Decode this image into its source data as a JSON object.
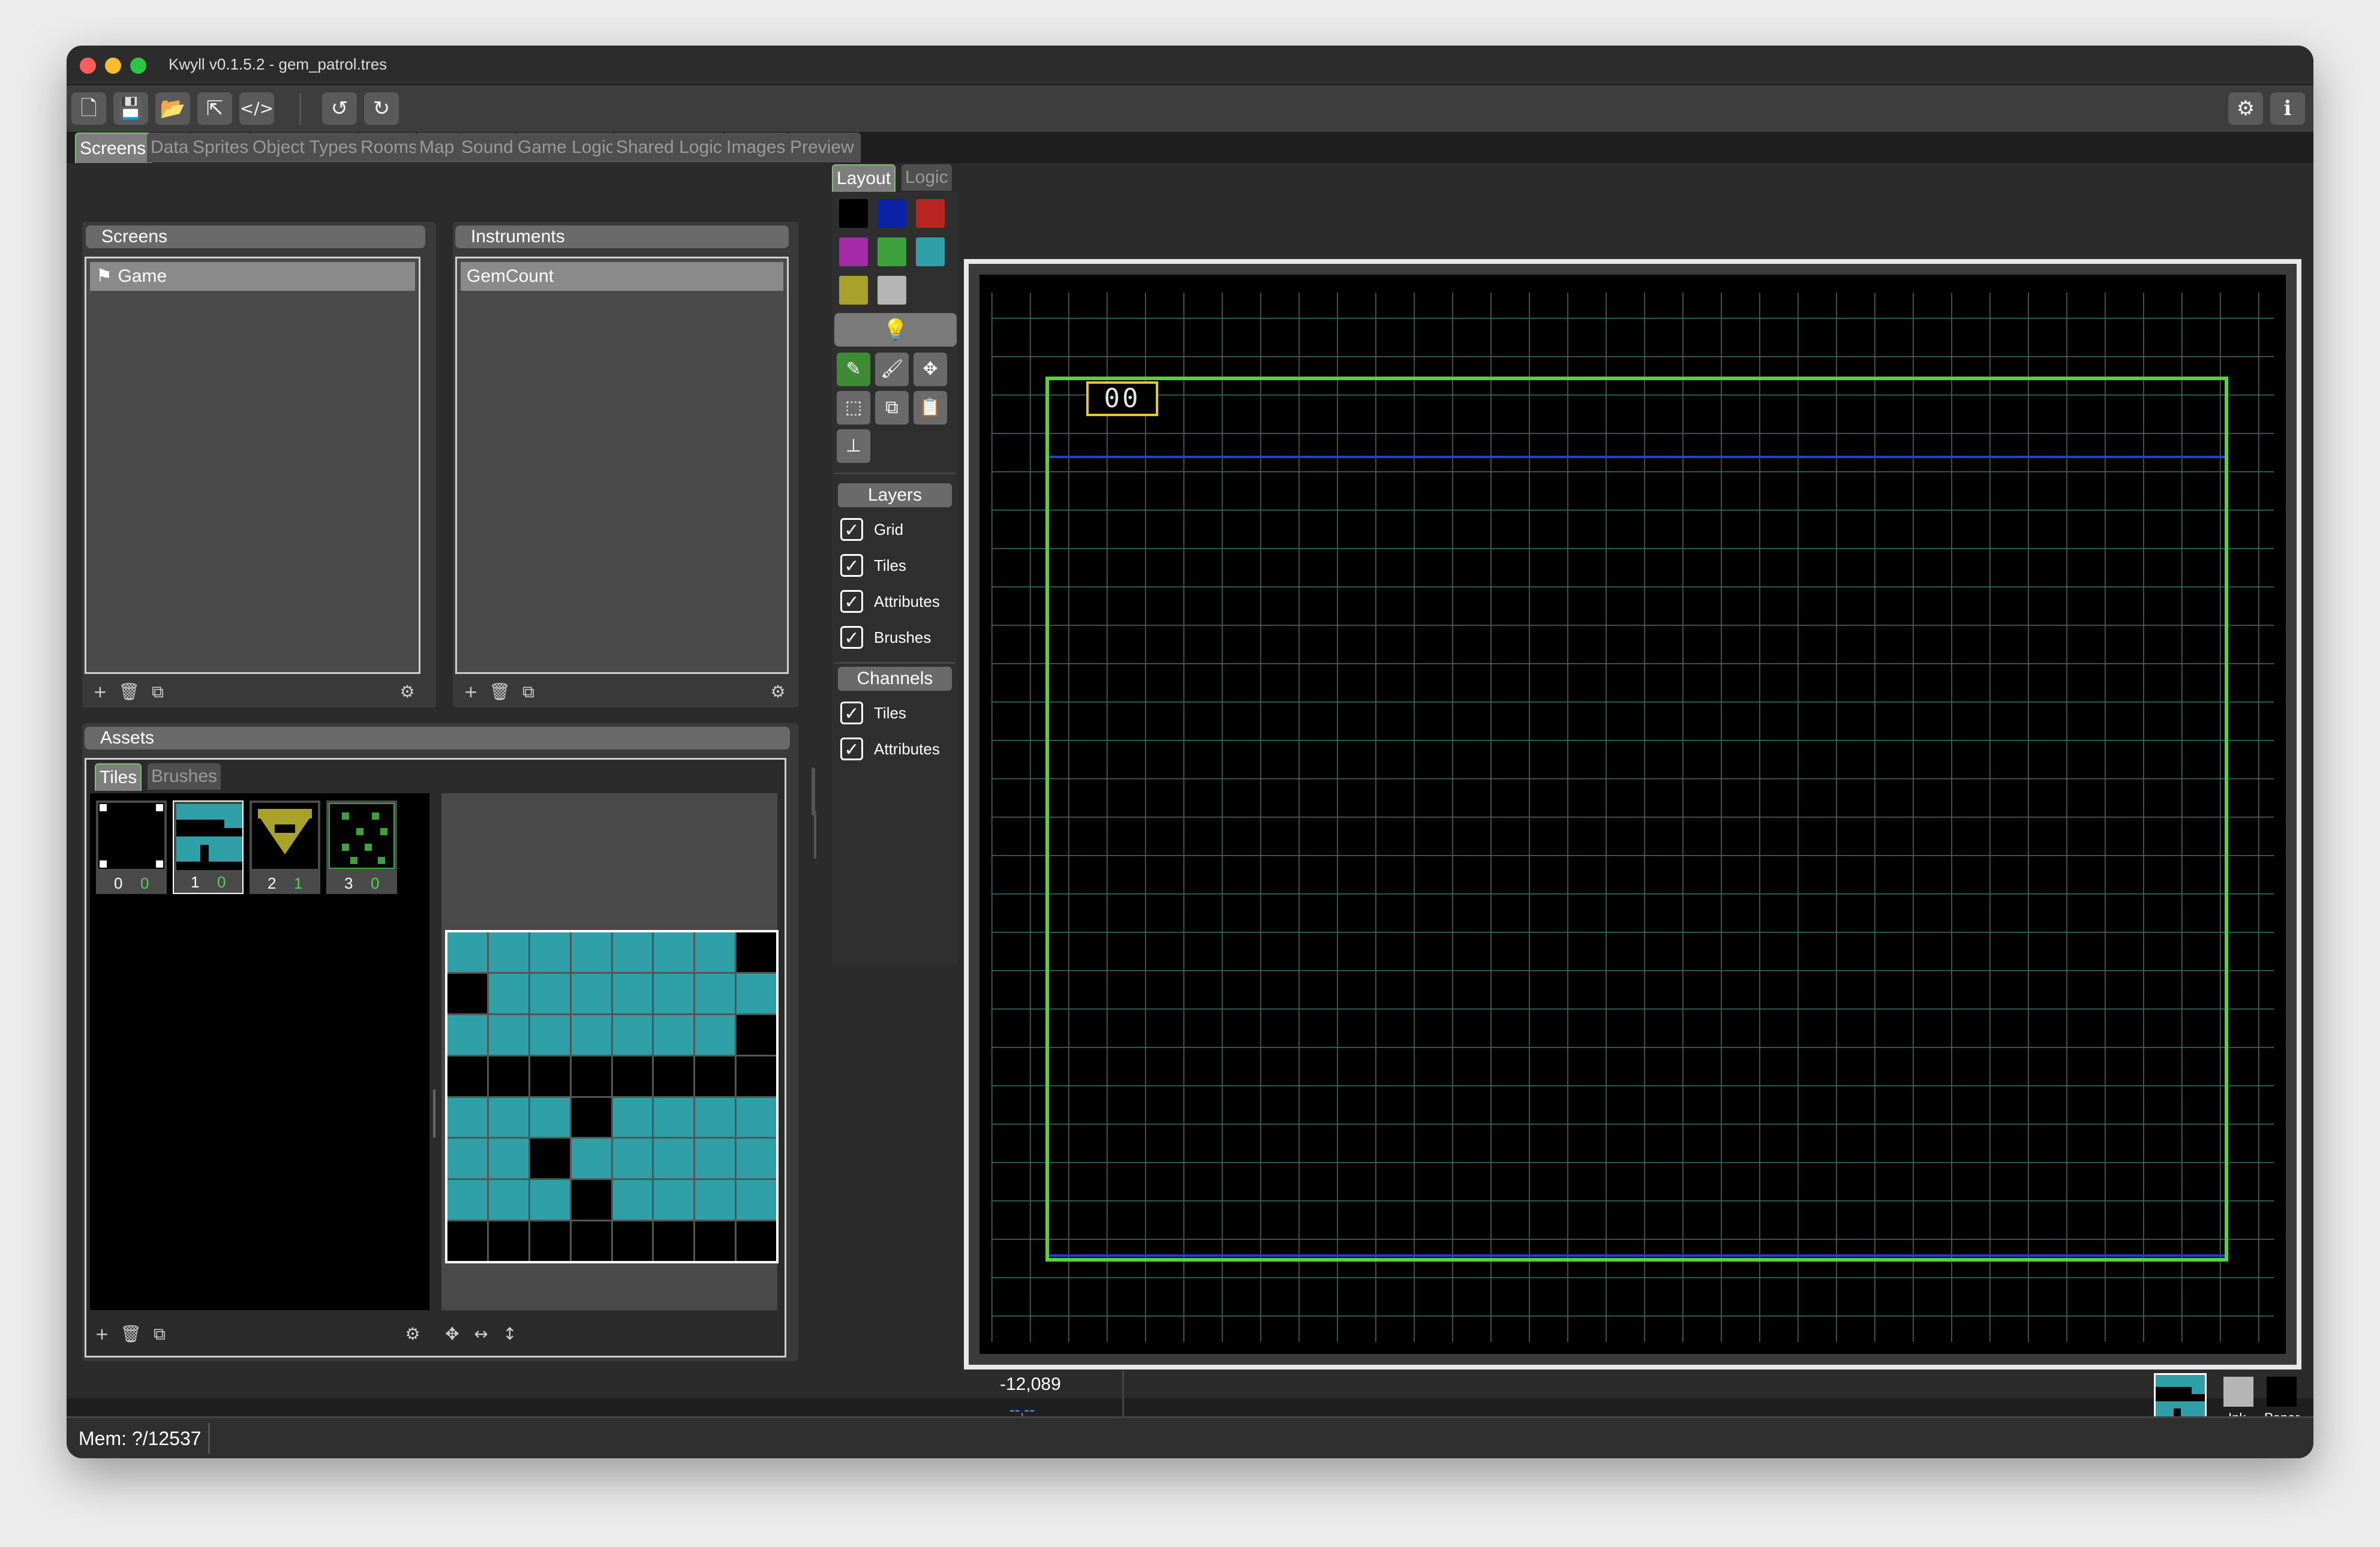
{
  "window": {
    "title": "Kwyll v0.1.5.2 - gem_patrol.tres",
    "colors": {
      "close": "#ff5f57",
      "minimize": "#febc2e",
      "zoom": "#28c840",
      "accent": "#77c46a"
    }
  },
  "toolbar": {
    "icons": [
      "new-file-icon",
      "save-icon",
      "open-folder-icon",
      "export-icon",
      "code-icon",
      "undo-icon",
      "redo-icon",
      "settings-icon",
      "info-icon"
    ]
  },
  "tabs": [
    {
      "label": "Screens",
      "active": true
    },
    {
      "label": "Data"
    },
    {
      "label": "Sprites"
    },
    {
      "label": "Object Types"
    },
    {
      "label": "Rooms"
    },
    {
      "label": "Map"
    },
    {
      "label": "Sound"
    },
    {
      "label": "Game Logic"
    },
    {
      "label": "Shared Logic"
    },
    {
      "label": "Images"
    },
    {
      "label": "Preview"
    }
  ],
  "screens_panel": {
    "title": "Screens",
    "items": [
      "Game"
    ]
  },
  "instruments_panel": {
    "title": "Instruments",
    "items": [
      "GemCount"
    ]
  },
  "assets": {
    "title": "Assets",
    "subtabs": [
      "Tiles",
      "Brushes"
    ],
    "tiles": [
      {
        "index": "0",
        "attr": "0"
      },
      {
        "index": "1",
        "attr": "0"
      },
      {
        "index": "2",
        "attr": "1"
      },
      {
        "index": "3",
        "attr": "0"
      }
    ]
  },
  "editor": {
    "subtabs": [
      "Layout",
      "Logic"
    ],
    "palette": [
      "#000000",
      "#0b22a8",
      "#b8241e",
      "#a52aa8",
      "#3ca33c",
      "#2fa0a8",
      "#a8a22c",
      "#b5b5b5"
    ],
    "layers": {
      "title": "Layers",
      "items": [
        "Grid",
        "Tiles",
        "Attributes",
        "Brushes"
      ]
    },
    "channels": {
      "title": "Channels",
      "items": [
        "Tiles",
        "Attributes"
      ]
    }
  },
  "canvas": {
    "screen_text": "00",
    "coords": "-12,089",
    "cursor_a": "--,--",
    "cursor_b": "--,--"
  },
  "ink_paper": {
    "ink_label": "Ink",
    "paper_label": "Paper",
    "ink_color": "#b5b5b5",
    "paper_color": "#000000"
  },
  "status": {
    "mem": "Mem: ?/12537"
  }
}
